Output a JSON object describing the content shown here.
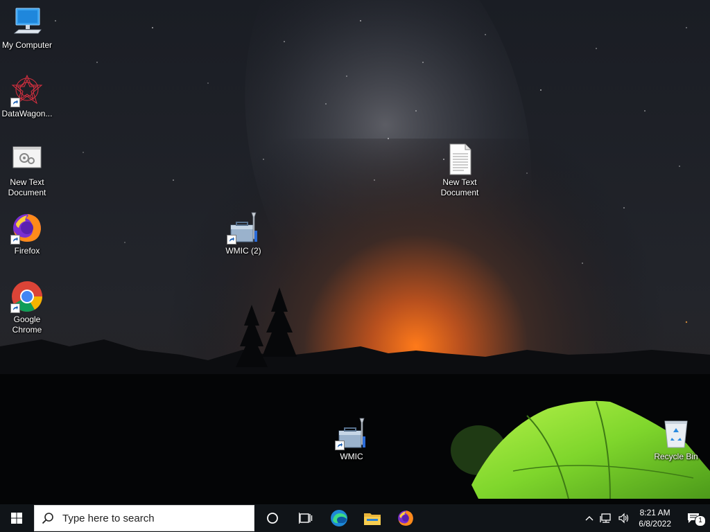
{
  "desktop": {
    "icons": [
      {
        "label": "My Computer"
      },
      {
        "label": "DataWagon..."
      },
      {
        "label": "New Text Document"
      },
      {
        "label": "Firefox"
      },
      {
        "label": "Google Chrome"
      },
      {
        "label": "WMIC (2)"
      },
      {
        "label": "New Text Document"
      },
      {
        "label": "WMIC"
      },
      {
        "label": "Recycle Bin"
      }
    ]
  },
  "taskbar": {
    "search_placeholder": "Type here to search",
    "pinned": [
      {
        "icon": "cortana-icon"
      },
      {
        "icon": "task-view-icon"
      },
      {
        "icon": "edge-icon"
      },
      {
        "icon": "file-explorer-icon"
      },
      {
        "icon": "firefox-icon"
      }
    ],
    "clock": {
      "time": "8:21 AM",
      "date": "6/8/2022"
    },
    "notification_count": "1"
  },
  "colors": {
    "taskbar_bg": "#101418",
    "tent_green": "#8fe03a",
    "sunset_orange": "#e0701c"
  }
}
